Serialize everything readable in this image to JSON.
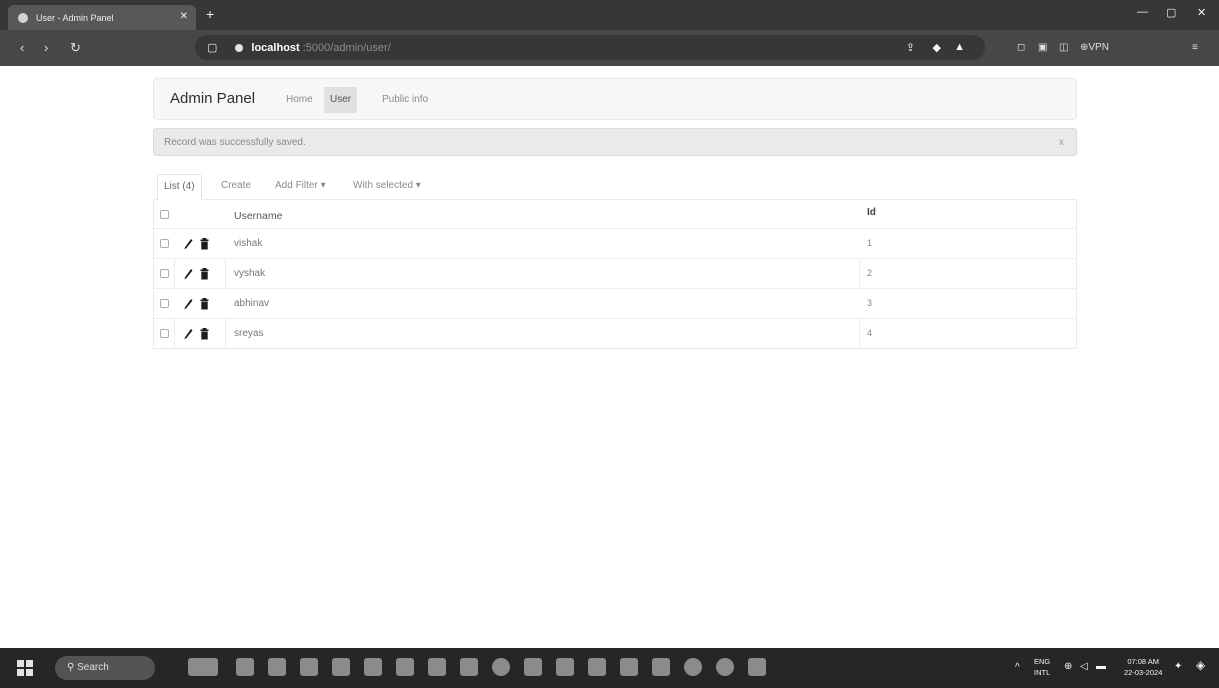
{
  "browser": {
    "tab_title": "User - Admin Panel",
    "tab_close": "✕",
    "new_tab": "+",
    "url_host": "localhost",
    "url_path": ":5000/admin/user/",
    "vpn_label": "⊕VPN",
    "window_controls": {
      "minimize": "—",
      "maximize": "▢",
      "close": "✕"
    }
  },
  "navbar": {
    "brand": "Admin Panel",
    "links": [
      {
        "label": "Home",
        "active": false
      },
      {
        "label": "User",
        "active": true
      },
      {
        "label": "Public info",
        "active": false
      }
    ]
  },
  "alert": {
    "message": "Record was successfully saved.",
    "close": "x"
  },
  "list_tabs": {
    "list": "List (4)",
    "create": "Create",
    "add_filter": "Add Filter ▾",
    "with_selected": "With selected ▾"
  },
  "table": {
    "columns": {
      "username": "Username",
      "id": "Id"
    },
    "rows": [
      {
        "username": "vishak",
        "id": "1"
      },
      {
        "username": "vyshak",
        "id": "2"
      },
      {
        "username": "abhinav",
        "id": "3"
      },
      {
        "username": "sreyas",
        "id": "4"
      }
    ]
  },
  "taskbar": {
    "search_label": "Search",
    "lang_top": "ENG",
    "lang_bottom": "INTL",
    "time": "07:08 AM",
    "date": "22-03-2024"
  }
}
